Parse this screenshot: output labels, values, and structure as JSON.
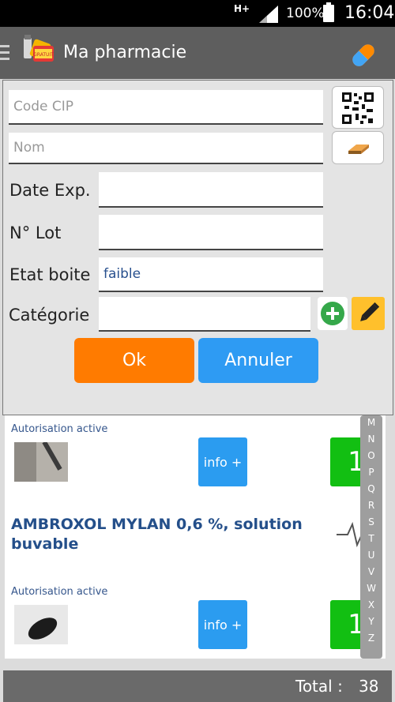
{
  "status_bar": {
    "network": "H+",
    "battery": "100%",
    "time": "16:04"
  },
  "action_bar": {
    "title": "Ma pharmacie",
    "logo_badge": "GRATUIT",
    "icons": [
      "menu-icon",
      "app-logo-icon",
      "pill-icon"
    ]
  },
  "dialog": {
    "code_cip_placeholder": "Code CIP",
    "nom_placeholder": "Nom",
    "date_exp_label": "Date Exp.",
    "date_exp_value": "",
    "lot_label": "N° Lot",
    "lot_value": "",
    "etat_label": "Etat boite",
    "etat_value": "faible",
    "categorie_label": "Catégorie",
    "categorie_value": "",
    "ok_label": "Ok",
    "cancel_label": "Annuler",
    "colors": {
      "ok": "#ff7b00",
      "cancel": "#2e9bf3",
      "add": "#35a84a",
      "edit": "#ffc02c"
    }
  },
  "list": {
    "items": [
      {
        "name": "",
        "authorization": "Autorisation active",
        "info_label": "info +",
        "quantity": "1"
      },
      {
        "name": "AMBROXOL MYLAN 0,6 %, solution buvable",
        "authorization": "Autorisation active",
        "info_label": "info +",
        "quantity": "1"
      }
    ],
    "alpha_index": [
      "M",
      "N",
      "O",
      "P",
      "Q",
      "R",
      "S",
      "T",
      "U",
      "V",
      "W",
      "X",
      "Y",
      "Z"
    ]
  },
  "footer": {
    "total_label": "Total :",
    "total_value": "38"
  }
}
